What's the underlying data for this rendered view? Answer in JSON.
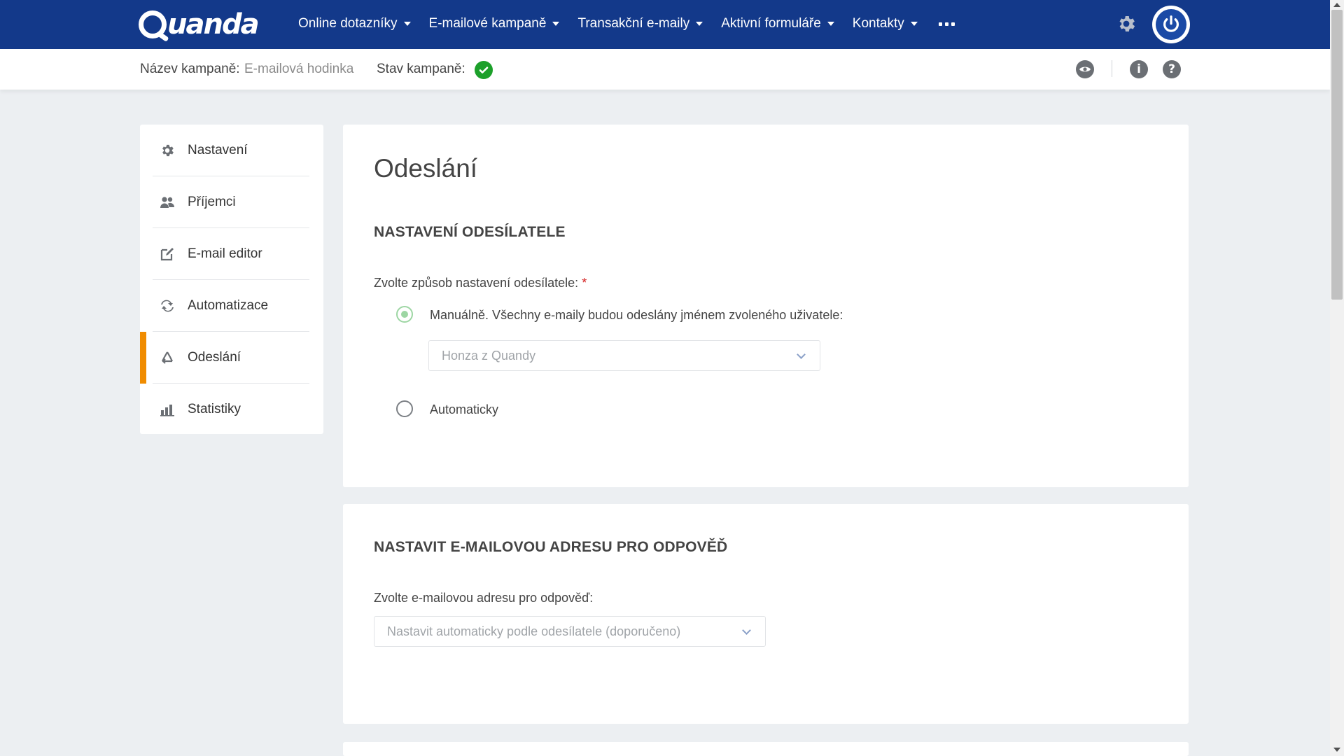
{
  "app": {
    "logo_text": "Quanda"
  },
  "nav": {
    "items": [
      {
        "label": "Online dotazníky"
      },
      {
        "label": "E-mailové kampaně"
      },
      {
        "label": "Transakční e-maily"
      },
      {
        "label": "Aktivní formuláře"
      },
      {
        "label": "Kontakty"
      }
    ],
    "more_icon": "ellipsis-icon",
    "settings_icon": "gear-icon",
    "power_icon": "power-icon"
  },
  "campaign": {
    "name_label": "Název kampaně:",
    "name_value": "E-mailová hodinka",
    "status_label": "Stav kampaně:",
    "status_icon": "check-circle-icon",
    "status_color": "#1ca02a"
  },
  "toolbar": {
    "preview_icon": "eye-icon",
    "info_icon": "info-icon",
    "help_icon": "question-icon",
    "info_glyph": "i",
    "help_glyph": "?"
  },
  "sidebar": {
    "items": [
      {
        "label": "Nastavení",
        "icon": "gear-icon",
        "active": false
      },
      {
        "label": "Příjemci",
        "icon": "users-icon",
        "active": false
      },
      {
        "label": "E-mail editor",
        "icon": "edit-icon",
        "active": false
      },
      {
        "label": "Automatizace",
        "icon": "refresh-icon",
        "active": false
      },
      {
        "label": "Odeslání",
        "icon": "recycle-icon",
        "active": true
      },
      {
        "label": "Statistiky",
        "icon": "bar-chart-icon",
        "active": false
      }
    ],
    "accent_color": "#f08c00"
  },
  "main": {
    "page_title": "Odeslání",
    "sender": {
      "section_title": "NASTAVENÍ ODESÍLATELE",
      "field_label": "Zvolte způsob nastavení odesílatele:",
      "required_mark": "*",
      "option_manual": "Manuálně. Všechny e-maily budou odeslány jménem zvoleného uživatele:",
      "option_manual_selected": true,
      "user_select_value": "Honza z Quandy",
      "option_auto": "Automaticky",
      "option_auto_selected": false
    },
    "reply": {
      "section_title": "NASTAVIT E-MAILOVOU ADRESU PRO ODPOVĚĎ",
      "field_label": "Zvolte e-mailovou adresu pro odpověď:",
      "select_value": "Nastavit automaticky podle odesílatele (doporučeno)"
    }
  }
}
